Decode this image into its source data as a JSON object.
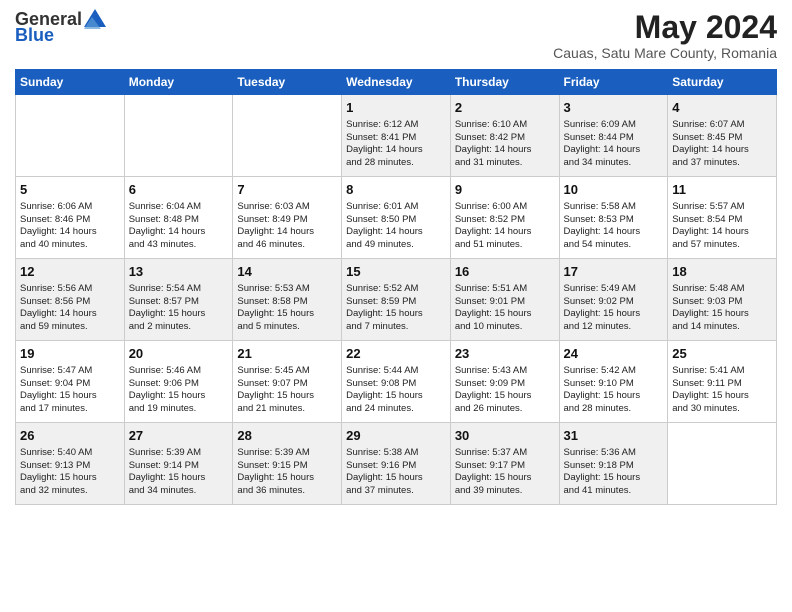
{
  "logo": {
    "general": "General",
    "blue": "Blue"
  },
  "title": "May 2024",
  "subtitle": "Cauas, Satu Mare County, Romania",
  "days_of_week": [
    "Sunday",
    "Monday",
    "Tuesday",
    "Wednesday",
    "Thursday",
    "Friday",
    "Saturday"
  ],
  "weeks": [
    [
      {
        "day": "",
        "info": ""
      },
      {
        "day": "",
        "info": ""
      },
      {
        "day": "",
        "info": ""
      },
      {
        "day": "1",
        "info": "Sunrise: 6:12 AM\nSunset: 8:41 PM\nDaylight: 14 hours\nand 28 minutes."
      },
      {
        "day": "2",
        "info": "Sunrise: 6:10 AM\nSunset: 8:42 PM\nDaylight: 14 hours\nand 31 minutes."
      },
      {
        "day": "3",
        "info": "Sunrise: 6:09 AM\nSunset: 8:44 PM\nDaylight: 14 hours\nand 34 minutes."
      },
      {
        "day": "4",
        "info": "Sunrise: 6:07 AM\nSunset: 8:45 PM\nDaylight: 14 hours\nand 37 minutes."
      }
    ],
    [
      {
        "day": "5",
        "info": "Sunrise: 6:06 AM\nSunset: 8:46 PM\nDaylight: 14 hours\nand 40 minutes."
      },
      {
        "day": "6",
        "info": "Sunrise: 6:04 AM\nSunset: 8:48 PM\nDaylight: 14 hours\nand 43 minutes."
      },
      {
        "day": "7",
        "info": "Sunrise: 6:03 AM\nSunset: 8:49 PM\nDaylight: 14 hours\nand 46 minutes."
      },
      {
        "day": "8",
        "info": "Sunrise: 6:01 AM\nSunset: 8:50 PM\nDaylight: 14 hours\nand 49 minutes."
      },
      {
        "day": "9",
        "info": "Sunrise: 6:00 AM\nSunset: 8:52 PM\nDaylight: 14 hours\nand 51 minutes."
      },
      {
        "day": "10",
        "info": "Sunrise: 5:58 AM\nSunset: 8:53 PM\nDaylight: 14 hours\nand 54 minutes."
      },
      {
        "day": "11",
        "info": "Sunrise: 5:57 AM\nSunset: 8:54 PM\nDaylight: 14 hours\nand 57 minutes."
      }
    ],
    [
      {
        "day": "12",
        "info": "Sunrise: 5:56 AM\nSunset: 8:56 PM\nDaylight: 14 hours\nand 59 minutes."
      },
      {
        "day": "13",
        "info": "Sunrise: 5:54 AM\nSunset: 8:57 PM\nDaylight: 15 hours\nand 2 minutes."
      },
      {
        "day": "14",
        "info": "Sunrise: 5:53 AM\nSunset: 8:58 PM\nDaylight: 15 hours\nand 5 minutes."
      },
      {
        "day": "15",
        "info": "Sunrise: 5:52 AM\nSunset: 8:59 PM\nDaylight: 15 hours\nand 7 minutes."
      },
      {
        "day": "16",
        "info": "Sunrise: 5:51 AM\nSunset: 9:01 PM\nDaylight: 15 hours\nand 10 minutes."
      },
      {
        "day": "17",
        "info": "Sunrise: 5:49 AM\nSunset: 9:02 PM\nDaylight: 15 hours\nand 12 minutes."
      },
      {
        "day": "18",
        "info": "Sunrise: 5:48 AM\nSunset: 9:03 PM\nDaylight: 15 hours\nand 14 minutes."
      }
    ],
    [
      {
        "day": "19",
        "info": "Sunrise: 5:47 AM\nSunset: 9:04 PM\nDaylight: 15 hours\nand 17 minutes."
      },
      {
        "day": "20",
        "info": "Sunrise: 5:46 AM\nSunset: 9:06 PM\nDaylight: 15 hours\nand 19 minutes."
      },
      {
        "day": "21",
        "info": "Sunrise: 5:45 AM\nSunset: 9:07 PM\nDaylight: 15 hours\nand 21 minutes."
      },
      {
        "day": "22",
        "info": "Sunrise: 5:44 AM\nSunset: 9:08 PM\nDaylight: 15 hours\nand 24 minutes."
      },
      {
        "day": "23",
        "info": "Sunrise: 5:43 AM\nSunset: 9:09 PM\nDaylight: 15 hours\nand 26 minutes."
      },
      {
        "day": "24",
        "info": "Sunrise: 5:42 AM\nSunset: 9:10 PM\nDaylight: 15 hours\nand 28 minutes."
      },
      {
        "day": "25",
        "info": "Sunrise: 5:41 AM\nSunset: 9:11 PM\nDaylight: 15 hours\nand 30 minutes."
      }
    ],
    [
      {
        "day": "26",
        "info": "Sunrise: 5:40 AM\nSunset: 9:13 PM\nDaylight: 15 hours\nand 32 minutes."
      },
      {
        "day": "27",
        "info": "Sunrise: 5:39 AM\nSunset: 9:14 PM\nDaylight: 15 hours\nand 34 minutes."
      },
      {
        "day": "28",
        "info": "Sunrise: 5:39 AM\nSunset: 9:15 PM\nDaylight: 15 hours\nand 36 minutes."
      },
      {
        "day": "29",
        "info": "Sunrise: 5:38 AM\nSunset: 9:16 PM\nDaylight: 15 hours\nand 37 minutes."
      },
      {
        "day": "30",
        "info": "Sunrise: 5:37 AM\nSunset: 9:17 PM\nDaylight: 15 hours\nand 39 minutes."
      },
      {
        "day": "31",
        "info": "Sunrise: 5:36 AM\nSunset: 9:18 PM\nDaylight: 15 hours\nand 41 minutes."
      },
      {
        "day": "",
        "info": ""
      }
    ]
  ]
}
